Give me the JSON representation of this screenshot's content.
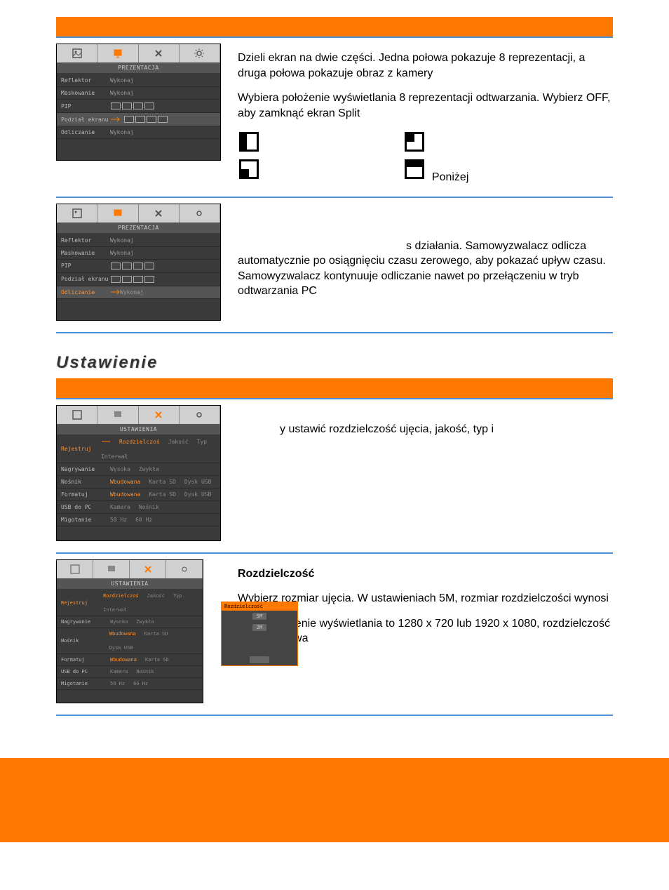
{
  "section1": {
    "shot": {
      "title": "PREZENTACJA",
      "rows": [
        {
          "label": "Reflektor",
          "value": "Wykonaj"
        },
        {
          "label": "Maskowanie",
          "value": "Wykonaj"
        },
        {
          "label": "PIP",
          "value": ""
        },
        {
          "label": "Podział ekranu",
          "value": ""
        },
        {
          "label": "Odliczanie",
          "value": "Wykonaj"
        }
      ]
    },
    "para1": "Dzieli ekran na dwie części. Jedna połowa pokazuje 8 reprezentacji, a druga połowa pokazuje obraz z kamery",
    "para2": "Wybiera położenie wyświetlania 8 reprezentacji odtwarzania. Wybierz OFF, aby zamknąć ekran Split",
    "below": "Poniżej"
  },
  "section2": {
    "shot": {
      "title": "PREZENTACJA",
      "rows": [
        {
          "label": "Reflektor",
          "value": "Wykonaj"
        },
        {
          "label": "Maskowanie",
          "value": "Wykonaj"
        },
        {
          "label": "PIP",
          "value": ""
        },
        {
          "label": "Podział ekranu",
          "value": ""
        },
        {
          "label": "Odliczanie",
          "value": "Wykonaj"
        }
      ]
    },
    "para": "s działania. Samowyzwalacz odlicza automatycznie po osiągnięciu czasu zerowego, aby pokazać upływ czasu. Samowyzwalacz kontynuuje odliczanie nawet po przełączeniu w tryb odtwarzania PC"
  },
  "heading": "Ustawienie",
  "section3": {
    "shot": {
      "title": "USTAWIENIA",
      "rows": [
        {
          "label": "Rejestruj",
          "opts": [
            "Rozdzielczoś",
            "Jakość",
            "Typ",
            "Interwał"
          ],
          "sel": 0
        },
        {
          "label": "Nagrywanie",
          "opts": [
            "Wysoka",
            "Zwykła"
          ]
        },
        {
          "label": "Nośnik",
          "opts": [
            "Wbudowana",
            "Karta SD",
            "Dysk USB"
          ]
        },
        {
          "label": "Formatuj",
          "opts": [
            "Wbudowana",
            "Karta SD",
            "Dysk USB"
          ]
        },
        {
          "label": "USB do PC",
          "opts": [
            "Kamera",
            "Nośnik"
          ]
        },
        {
          "label": "Migotanie",
          "opts": [
            "50 Hz",
            "60 Hz"
          ]
        }
      ]
    },
    "para": "y ustawić rozdzielczość ujęcia, jakość, typ i"
  },
  "section4": {
    "shot": {
      "title": "USTAWIENIA",
      "rows": [
        {
          "label": "Rejestruj",
          "opts": [
            "Rozdzielczoś",
            "Jakość",
            "Typ",
            "Interwał"
          ]
        },
        {
          "label": "Nagrywanie",
          "opts": [
            "Wysoka",
            "Zwykła"
          ]
        },
        {
          "label": "Nośnik",
          "opts": [
            "Wbudowana",
            "Karta SD",
            "Dysk USB"
          ]
        },
        {
          "label": "Formatuj",
          "opts": [
            "Wbudowana",
            "Karta SD",
            "Dysk USB"
          ]
        },
        {
          "label": "USB do PC",
          "opts": [
            "Kamera",
            "Nośnik"
          ]
        },
        {
          "label": "Migotanie",
          "opts": [
            "50 Hz",
            "60 Hz"
          ]
        }
      ],
      "popup_title": "Rozdzielczość",
      "popup_opts": [
        "5M",
        "2M"
      ]
    },
    "heading": "Rozdzielczość",
    "p1": "Wybierz rozmiar ujęcia. W ustawieniach 5M, rozmiar rozdzielczości wynosi",
    "p2": "Jeśli ustawienie wyświetlania to 1280 x 720 lub 1920 x 1080, rozdzielczość przechwytywa"
  }
}
